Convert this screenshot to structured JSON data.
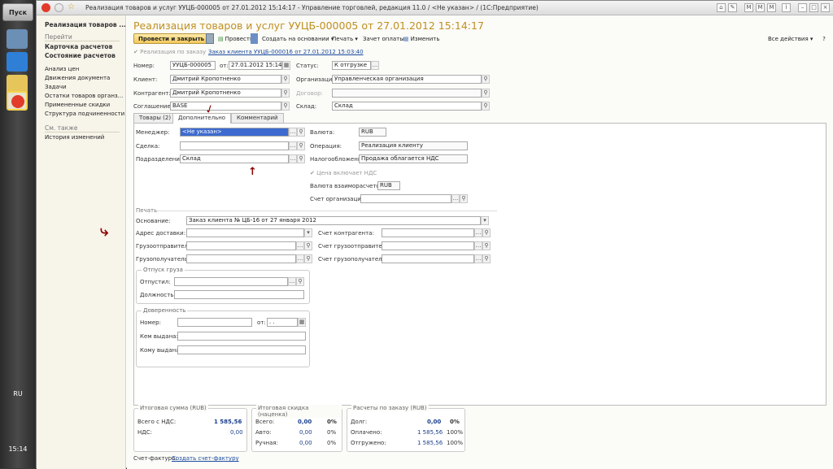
{
  "taskbar": {
    "start": "Пуск",
    "lang": "RU",
    "time": "15:14"
  },
  "window": {
    "title": "Реализация товаров и услуг УУЦБ-000005 от 27.01.2012 15:14:17 - Управление торговлей, редакция 11.0 / <Не указан> / (1С:Предприятие)"
  },
  "left": {
    "title": "Реализация товаров ...",
    "goto": "Перейти",
    "links_bold": [
      "Карточка расчетов",
      "Состояние расчетов"
    ],
    "links": [
      "Анализ цен",
      "Движения документа",
      "Задачи",
      "Остатки товаров органз...",
      "Примененные скидки",
      "Структура подчиненности"
    ],
    "see_also": "См. также",
    "see_links": [
      "История изменений"
    ]
  },
  "header": {
    "title": "Реализация товаров и услуг УУЦБ-000005 от 27.01.2012 15:14:17"
  },
  "toolbar": {
    "post_close": "Провести и закрыть",
    "post": "Провести",
    "create_based": "Создать на основании",
    "print": "Печать",
    "payment_offset": "Зачет оплаты",
    "edit": "Изменить",
    "all_actions": "Все действия"
  },
  "order": {
    "checkbox": "Реализация по заказу",
    "link": "Заказ клиента УУЦБ-000016 от 27.01.2012 15:03:40"
  },
  "fields": {
    "number_label": "Номер:",
    "number": "УУЦБ-000005",
    "from_label": "от:",
    "date": "27.01.2012 15:14:17",
    "status_label": "Статус:",
    "status": "К отгрузке",
    "client_label": "Клиент:",
    "client": "Дмитрий Кропотненко",
    "org_label": "Организация:",
    "org": "Управленческая организация",
    "contractor_label": "Контрагент:",
    "contractor": "Дмитрий Кропотненко",
    "contract_label": "Договор:",
    "contract": "",
    "agreement_label": "Соглашение:",
    "agreement": "BASE",
    "warehouse_label": "Склад:",
    "warehouse": "Склад"
  },
  "tabs": [
    "Товары (2)",
    "Дополнительно",
    "Комментарий"
  ],
  "extra": {
    "manager_label": "Менеджер:",
    "manager": "<Не указан>",
    "deal_label": "Сделка:",
    "deal": "",
    "dept_label": "Подразделение:",
    "dept": "Склад",
    "currency_label": "Валюта:",
    "currency": "RUB",
    "operation_label": "Операция:",
    "operation": "Реализация клиенту",
    "tax_label": "Налогообложение:",
    "tax": "Продажа облагается НДС",
    "vat_incl": "Цена включает НДС",
    "settle_cur_label": "Валюта взаиморасчетов:",
    "settle_cur": "RUB",
    "org_acc_label": "Счет организации:",
    "org_acc": ""
  },
  "print": {
    "title": "Печать",
    "basis_label": "Основание:",
    "basis": "Заказ клиента № ЦБ-16 от 27 января 2012",
    "addr_label": "Адрес доставки:",
    "addr": "",
    "shipper_label": "Грузоотправитель:",
    "shipper": "",
    "consignee_label": "Грузополучатель:",
    "consignee": "",
    "acc_contr_label": "Счет контрагента:",
    "acc_shipper_label": "Счет грузоотправителя:",
    "acc_consignee_label": "Счет грузополучателя:"
  },
  "release": {
    "title": "Отпуск груза",
    "released_label": "Отпустил:",
    "position_label": "Должность:"
  },
  "proxy": {
    "title": "Доверенность",
    "number_label": "Номер:",
    "from_label": "от:",
    "date": " .  .",
    "issued_label": "Кем выдана:",
    "to_label": "Кому выдана:"
  },
  "totals": {
    "sum_title": "Итоговая сумма (RUB)",
    "total_vat_label": "Всего с НДС:",
    "total_vat": "1 585,56",
    "vat_label": "НДС:",
    "vat": "0,00",
    "disc_title": "Итоговая скидка (наценка)",
    "disc_total_label": "Всего:",
    "disc_total": "0,00",
    "disc_total_pct": "0%",
    "disc_auto_label": "Авто:",
    "disc_auto": "0,00",
    "disc_auto_pct": "0%",
    "disc_manual_label": "Ручная:",
    "disc_manual": "0,00",
    "disc_manual_pct": "0%",
    "pay_title": "Расчеты по заказу (RUB)",
    "debt_label": "Долг:",
    "debt": "0,00",
    "debt_pct": "0%",
    "paid_label": "Оплачено:",
    "paid": "1 585,56",
    "paid_pct": "100%",
    "shipped_label": "Отгружено:",
    "shipped": "1 585,56",
    "shipped_pct": "100%"
  },
  "invoice": {
    "label": "Счет-фактура:",
    "link": "Создать счет-фактуру"
  }
}
